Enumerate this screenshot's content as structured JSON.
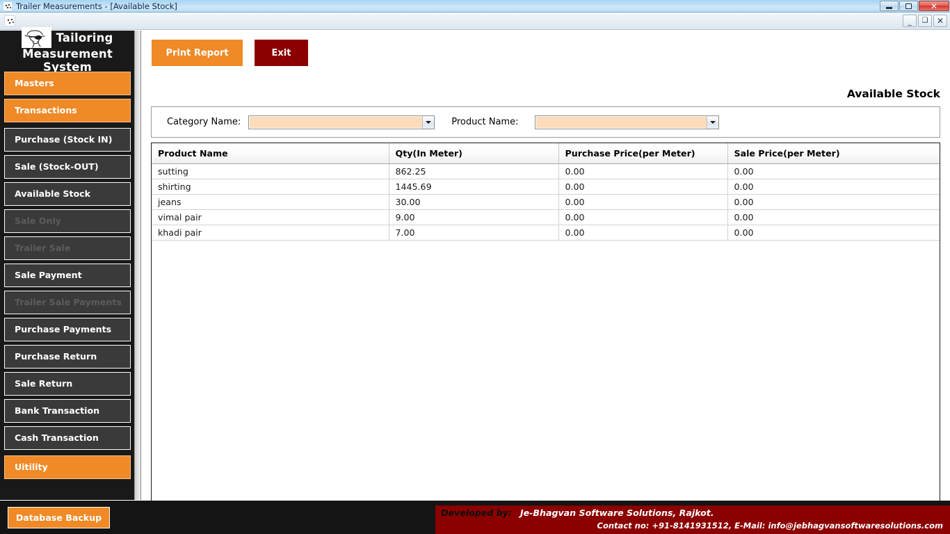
{
  "window": {
    "title": "Trailer Measurements - [Available Stock]",
    "app_icon": "tailor-app-icon",
    "controls": {
      "minimize": "—",
      "maximize": "❐",
      "close": "✕"
    }
  },
  "mdi": {
    "icon": "tailor-app-icon",
    "controls": {
      "minimize": "_",
      "restore": "❐",
      "close": "✕"
    }
  },
  "sidebar": {
    "brand": {
      "logo": "tailor-sketch-logo",
      "line1": "Tailoring",
      "line2": "Measurement System"
    },
    "items": [
      {
        "label": "Masters",
        "type": "group",
        "state": "enabled"
      },
      {
        "label": "Transactions",
        "type": "group",
        "state": "enabled"
      },
      {
        "label": "Purchase (Stock IN)",
        "type": "item",
        "state": "enabled"
      },
      {
        "label": "Sale (Stock-OUT)",
        "type": "item",
        "state": "enabled"
      },
      {
        "label": "Available Stock",
        "type": "item",
        "state": "enabled"
      },
      {
        "label": "Sale Only",
        "type": "item",
        "state": "disabled"
      },
      {
        "label": "Trailer Sale",
        "type": "item",
        "state": "disabled"
      },
      {
        "label": "Sale Payment",
        "type": "item",
        "state": "enabled"
      },
      {
        "label": "Trailer Sale Payments",
        "type": "item",
        "state": "disabled"
      },
      {
        "label": "Purchase Payments",
        "type": "item",
        "state": "enabled"
      },
      {
        "label": "Purchase Return",
        "type": "item",
        "state": "enabled"
      },
      {
        "label": "Sale Return",
        "type": "item",
        "state": "enabled"
      },
      {
        "label": "Bank Transaction",
        "type": "item",
        "state": "enabled"
      },
      {
        "label": "Cash Transaction",
        "type": "item",
        "state": "enabled"
      },
      {
        "label": "Uitility",
        "type": "group",
        "state": "enabled"
      }
    ],
    "backup_button": "Database Backup"
  },
  "toolbar": {
    "print_label": "Print Report",
    "exit_label": "Exit"
  },
  "main": {
    "page_title": "Available Stock",
    "filters": [
      {
        "label": "Category Name:",
        "value": "",
        "placeholder": "",
        "icon": "chevron-down-icon"
      },
      {
        "label": "Product Name:",
        "value": "",
        "placeholder": "",
        "icon": "chevron-down-icon"
      }
    ],
    "grid": {
      "columns": [
        "Product Name",
        "Qty(In Meter)",
        "Purchase Price(per Meter)",
        "Sale Price(per Meter)"
      ],
      "rows": [
        [
          "sutting",
          "862.25",
          "0.00",
          "0.00"
        ],
        [
          "shirting",
          "1445.69",
          "0.00",
          "0.00"
        ],
        [
          "jeans",
          "30.00",
          "0.00",
          "0.00"
        ],
        [
          "vimal pair",
          "9.00",
          "0.00",
          "0.00"
        ],
        [
          "khadi pair",
          "7.00",
          "0.00",
          "0.00"
        ]
      ]
    }
  },
  "footer": {
    "developed_by_label": "Developed by:",
    "company": "Je-Bhagvan Software Solutions, Rajkot.",
    "contact": "Contact no: +91-8141931512, E-Mail: info@jebhagvansoftwaresolutions.com"
  },
  "colors": {
    "accent_orange": "#ef8a27",
    "dark_red": "#8b0000",
    "sidebar_bg": "#191919",
    "menu_item_bg": "#3a3a3a",
    "combo_fill": "#fcdcba"
  }
}
